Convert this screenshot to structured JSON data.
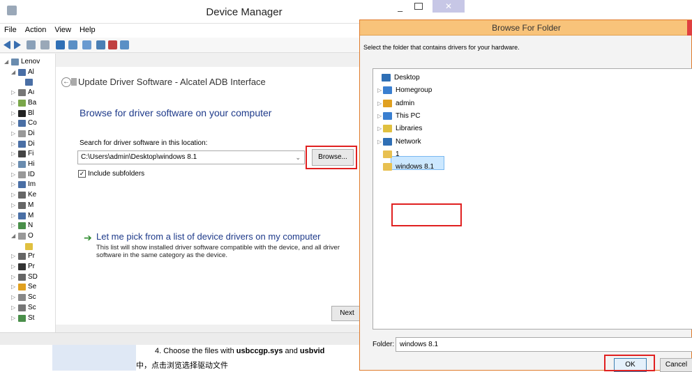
{
  "device_manager": {
    "title": "Device Manager",
    "menu": [
      "File",
      "Action",
      "View",
      "Help"
    ],
    "window_controls": {
      "minimize": "–",
      "close": "✕"
    },
    "tree": [
      {
        "label": "Lenov",
        "indent": 0,
        "arrow": "◢",
        "color": "#6a8caf"
      },
      {
        "label": "Al",
        "indent": 1,
        "arrow": "◢",
        "color": "#4a6fa5"
      },
      {
        "label": "",
        "indent": 2,
        "arrow": "",
        "color": "#4a6fa5"
      },
      {
        "label": "Aı",
        "indent": 1,
        "arrow": "▷",
        "color": "#777777"
      },
      {
        "label": "Ba",
        "indent": 1,
        "arrow": "▷",
        "color": "#7aa64a"
      },
      {
        "label": "Bl",
        "indent": 1,
        "arrow": "▷",
        "color": "#222222"
      },
      {
        "label": "Co",
        "indent": 1,
        "arrow": "▷",
        "color": "#4a6fa5"
      },
      {
        "label": "Di",
        "indent": 1,
        "arrow": "▷",
        "color": "#999999"
      },
      {
        "label": "Di",
        "indent": 1,
        "arrow": "▷",
        "color": "#4a6fa5"
      },
      {
        "label": "Fi",
        "indent": 1,
        "arrow": "▷",
        "color": "#444444"
      },
      {
        "label": "Hi",
        "indent": 1,
        "arrow": "▷",
        "color": "#6a8caf"
      },
      {
        "label": "ID",
        "indent": 1,
        "arrow": "▷",
        "color": "#999999"
      },
      {
        "label": "Im",
        "indent": 1,
        "arrow": "▷",
        "color": "#4a6fa5"
      },
      {
        "label": "Ke",
        "indent": 1,
        "arrow": "▷",
        "color": "#666666"
      },
      {
        "label": "M",
        "indent": 1,
        "arrow": "▷",
        "color": "#666666"
      },
      {
        "label": "M",
        "indent": 1,
        "arrow": "▷",
        "color": "#4a6fa5"
      },
      {
        "label": "N",
        "indent": 1,
        "arrow": "▷",
        "color": "#4a8f4a"
      },
      {
        "label": "O",
        "indent": 1,
        "arrow": "◢",
        "color": "#999999"
      },
      {
        "label": "",
        "indent": 2,
        "arrow": "",
        "color": "#e0c040"
      },
      {
        "label": "Pr",
        "indent": 1,
        "arrow": "▷",
        "color": "#666666"
      },
      {
        "label": "Pr",
        "indent": 1,
        "arrow": "▷",
        "color": "#333333"
      },
      {
        "label": "SD",
        "indent": 1,
        "arrow": "▷",
        "color": "#666666"
      },
      {
        "label": "Se",
        "indent": 1,
        "arrow": "▷",
        "color": "#e0a020"
      },
      {
        "label": "Sc",
        "indent": 1,
        "arrow": "▷",
        "color": "#888888"
      },
      {
        "label": "Sc",
        "indent": 1,
        "arrow": "▷",
        "color": "#777777"
      },
      {
        "label": "St",
        "indent": 1,
        "arrow": "▷",
        "color": "#4a8f4a"
      }
    ]
  },
  "update_driver": {
    "title": "Update Driver Software - Alcatel ADB Interface",
    "heading": "Browse for driver software on your computer",
    "search_label": "Search for driver software in this location:",
    "path_value": "C:\\Users\\admin\\Desktop\\windows 8.1",
    "browse_button": "Browse...",
    "include_subfolders": "Include subfolders",
    "pick_link": "Let me pick from a list of device drivers on my computer",
    "pick_desc": "This list will show installed driver software compatible with the device, and all driver software in the same category as the device.",
    "next_button": "Next"
  },
  "browse_folder": {
    "title": "Browse For Folder",
    "instruction": "Select the folder that contains drivers for your hardware.",
    "items": [
      {
        "label": "Desktop",
        "indent": 0,
        "arrow": "",
        "color": "#2f6fb5"
      },
      {
        "label": "Homegroup",
        "indent": 1,
        "arrow": "▷",
        "color": "#3a7fd0"
      },
      {
        "label": "admin",
        "indent": 1,
        "arrow": "▷",
        "color": "#e0a020"
      },
      {
        "label": "This PC",
        "indent": 1,
        "arrow": "▷",
        "color": "#3a7fd0"
      },
      {
        "label": "Libraries",
        "indent": 1,
        "arrow": "▷",
        "color": "#e0c040"
      },
      {
        "label": "Network",
        "indent": 1,
        "arrow": "▷",
        "color": "#2f6fb5"
      },
      {
        "label": "1",
        "indent": 1,
        "arrow": "",
        "color": "#e8c050"
      },
      {
        "label": "windows 8.1",
        "indent": 1,
        "arrow": "",
        "color": "#e8c050"
      }
    ],
    "folder_label": "Folder:",
    "folder_value": "windows 8.1",
    "ok_button": "OK",
    "cancel_button": "Cancel"
  },
  "caption": {
    "line1_a": "4. Choose the files with ",
    "line1_b": "usbccgp.sys",
    "line1_c": " and ",
    "line1_d": "usbvid",
    "line2": "中，点击浏览选择驱动文件"
  }
}
